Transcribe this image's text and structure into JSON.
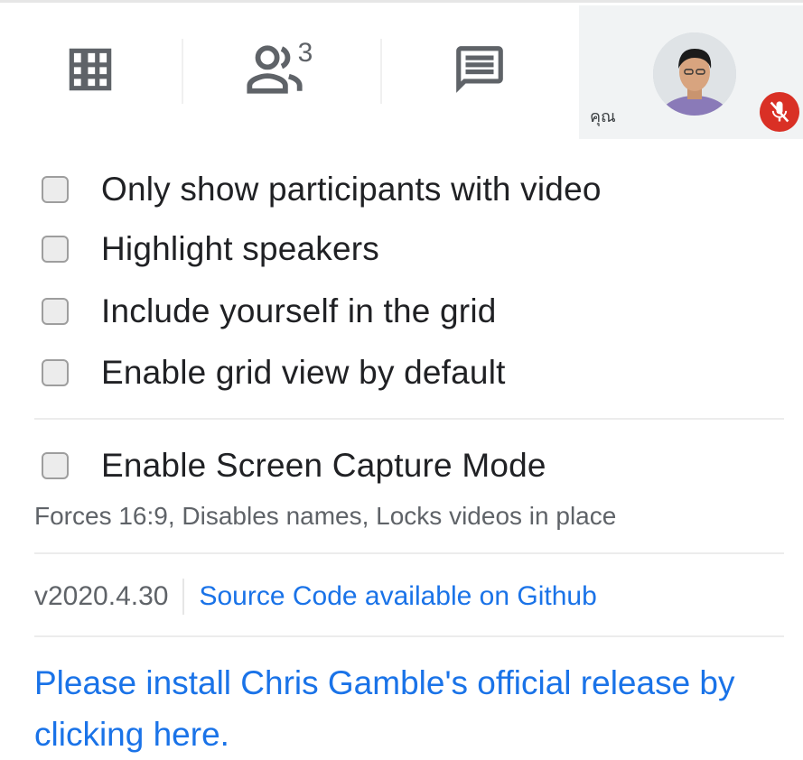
{
  "toolbar": {
    "grid_icon": "grid-view-icon",
    "people_icon": "people-icon",
    "participant_count": "3",
    "chat_icon": "chat-icon",
    "self_label": "คุณ",
    "mute_icon": "mic-off-icon",
    "mute_color": "#d93025"
  },
  "options": [
    {
      "label": "Only show participants with video",
      "checked": false
    },
    {
      "label": "Highlight speakers",
      "checked": false
    },
    {
      "label": "Include yourself in the grid",
      "checked": false
    },
    {
      "label": "Enable grid view by default",
      "checked": false
    }
  ],
  "screen_capture": {
    "label": "Enable Screen Capture Mode",
    "checked": false,
    "description": "Forces 16:9, Disables names, Locks videos in place"
  },
  "footer": {
    "version": "v2020.4.30",
    "source_link": "Source Code available on Github",
    "install_link": "Please install Chris Gamble's official release by clicking here.",
    "link_color": "#1a73e8"
  }
}
